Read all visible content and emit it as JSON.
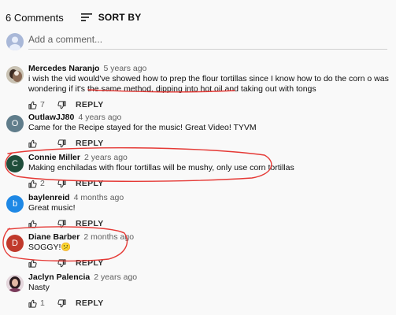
{
  "header": {
    "count_label": "6 Comments",
    "sort_label": "SORT BY"
  },
  "add_comment": {
    "placeholder": "Add a comment..."
  },
  "comments": [
    {
      "author": "Mercedes Naranjo",
      "time": "5 years ago",
      "text": "i wish the vid would've showed how to prep the flour tortillas since I know how to do the corn o was wondering if it's the same method. dipping into hot oil and taking out with tongs",
      "likes": "7",
      "reply_label": "REPLY"
    },
    {
      "author": "OutlawJJ80",
      "time": "4 years ago",
      "avatar_letter": "O",
      "text": "Came for the Recipe stayed for the music! Great Video! TYVM",
      "likes": "",
      "reply_label": "REPLY"
    },
    {
      "author": "Connie Miller",
      "time": "2 years ago",
      "avatar_letter": "C",
      "text": "Making enchiladas with flour tortillas will be mushy, only use corn tortillas",
      "likes": "2",
      "reply_label": "REPLY"
    },
    {
      "author": "baylenreid",
      "time": "4 months ago",
      "avatar_letter": "b",
      "text": "Great music!",
      "likes": "",
      "reply_label": "REPLY"
    },
    {
      "author": "Diane Barber",
      "time": "2 months ago",
      "avatar_letter": "D",
      "text": "SOGGY!😕",
      "likes": "",
      "reply_label": "REPLY"
    },
    {
      "author": "Jaclyn Palencia",
      "time": "2 years ago",
      "text": "Nasty",
      "likes": "1",
      "reply_label": "REPLY"
    }
  ],
  "colors": {
    "avatar_o": "#607d8b",
    "avatar_c": "#1f4d3a",
    "avatar_b": "#1e88e5",
    "avatar_d": "#c0392b",
    "annotation": "#e53935"
  }
}
